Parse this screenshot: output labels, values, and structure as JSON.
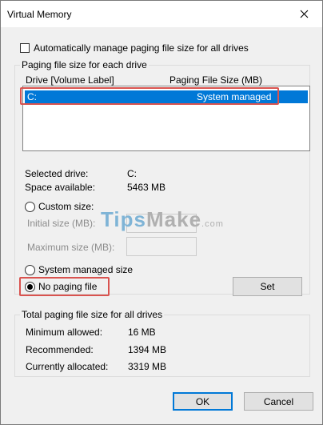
{
  "window": {
    "title": "Virtual Memory"
  },
  "auto_manage": {
    "label": "Automatically manage paging file size for all drives",
    "checked": false
  },
  "paging_group": {
    "legend": "Paging file size for each drive",
    "columns": {
      "drive": "Drive  [Volume Label]",
      "size": "Paging File Size (MB)"
    },
    "rows": [
      {
        "drive": "C:",
        "size": "System managed",
        "selected": true
      }
    ]
  },
  "selected_info": {
    "selected_drive_label": "Selected drive:",
    "selected_drive_value": "C:",
    "space_label": "Space available:",
    "space_value": "5463 MB"
  },
  "options": {
    "custom_size_label": "Custom size:",
    "initial_label": "Initial size (MB):",
    "initial_value": "",
    "maximum_label": "Maximum size (MB):",
    "maximum_value": "",
    "system_managed_label": "System managed size",
    "no_paging_label": "No paging file",
    "selected": "no_paging",
    "set_button": "Set"
  },
  "watermark": {
    "part1": "Tips",
    "part2": "Make",
    "part3": ".com"
  },
  "totals": {
    "legend": "Total paging file size for all drives",
    "minimum_label": "Minimum allowed:",
    "minimum_value": "16 MB",
    "recommended_label": "Recommended:",
    "recommended_value": "1394 MB",
    "current_label": "Currently allocated:",
    "current_value": "3319 MB"
  },
  "buttons": {
    "ok": "OK",
    "cancel": "Cancel"
  },
  "colors": {
    "selection": "#0078d7",
    "highlight_annotation": "#d9534f"
  }
}
